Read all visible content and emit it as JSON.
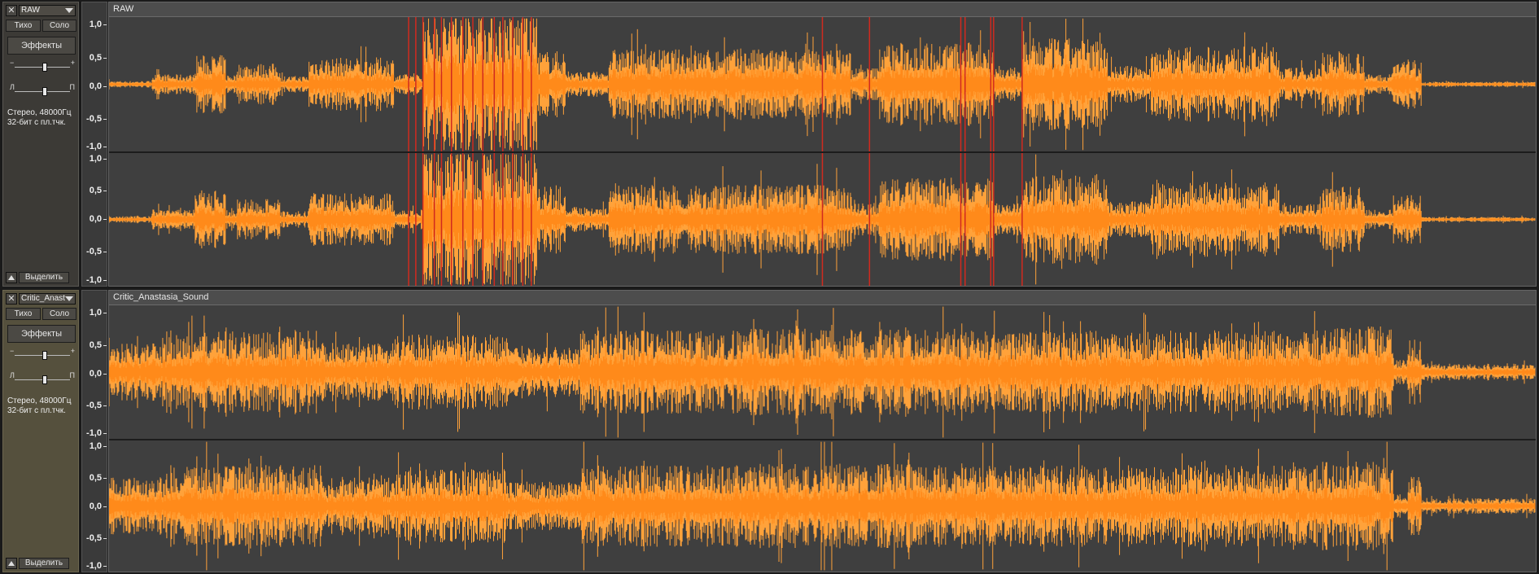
{
  "colors": {
    "wave": "#ffa23a",
    "wave_rms": "#ff8a1a",
    "clip": "#d12a1f",
    "canvas": "#3f3f3f"
  },
  "tracks": [
    {
      "name": "RAW",
      "clip_name": "RAW",
      "mute_label": "Тихо",
      "solo_label": "Соло",
      "effects_label": "Эффекты",
      "gain_minus": "−",
      "gain_plus": "+",
      "pan_left": "Л",
      "pan_right": "П",
      "format_line1": "Стерео, 48000Гц",
      "format_line2": "32-бит с пл.тчк.",
      "select_label": "Выделить",
      "scale": [
        "1,0",
        "0,5",
        "0,0",
        "-0,5",
        "-1,0"
      ]
    },
    {
      "name": "Critic_Anast",
      "clip_name": "Critic_Anastasia_Sound",
      "mute_label": "Тихо",
      "solo_label": "Соло",
      "effects_label": "Эффекты",
      "gain_minus": "−",
      "gain_plus": "+",
      "pan_left": "Л",
      "pan_right": "П",
      "format_line1": "Стерео, 48000Гц",
      "format_line2": "32-бит с пл.тчк.",
      "select_label": "Выделить",
      "scale": [
        "1,0",
        "0,5",
        "0,0",
        "-0,5",
        "-1,0"
      ]
    }
  ]
}
